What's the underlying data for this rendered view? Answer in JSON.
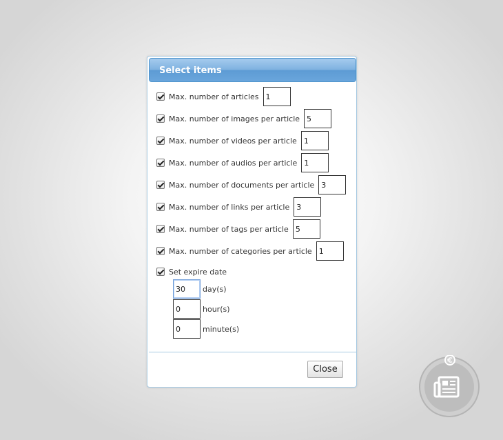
{
  "dialog": {
    "title": "Select items",
    "options": [
      {
        "label": "Max. number of articles",
        "value": "1",
        "checked": true
      },
      {
        "label": "Max. number of images per article",
        "value": "5",
        "checked": true
      },
      {
        "label": "Max. number of videos per article",
        "value": "1",
        "checked": true
      },
      {
        "label": "Max. number of audios per article",
        "value": "1",
        "checked": true
      },
      {
        "label": "Max. number of documents per article",
        "value": "3",
        "checked": true
      },
      {
        "label": "Max. number of links per article",
        "value": "3",
        "checked": true
      },
      {
        "label": "Max. number of tags per article",
        "value": "5",
        "checked": true
      },
      {
        "label": "Max. number of categories per article",
        "value": "1",
        "checked": true
      }
    ],
    "expire": {
      "label": "Set expire date",
      "checked": true,
      "days_value": "30",
      "days_unit": "day(s)",
      "hours_value": "0",
      "hours_unit": "hour(s)",
      "minutes_value": "0",
      "minutes_unit": "minute(s)"
    },
    "close_label": "Close"
  },
  "widget": {
    "icon": "newspaper-icon",
    "badge_icon": "euro-coin-icon"
  },
  "colors": {
    "titlebar": "#6aa6dc",
    "dialog_border": "#a6c9e2",
    "focus_border": "#6f9dd9",
    "widget_gray": "#b9b9b9"
  }
}
